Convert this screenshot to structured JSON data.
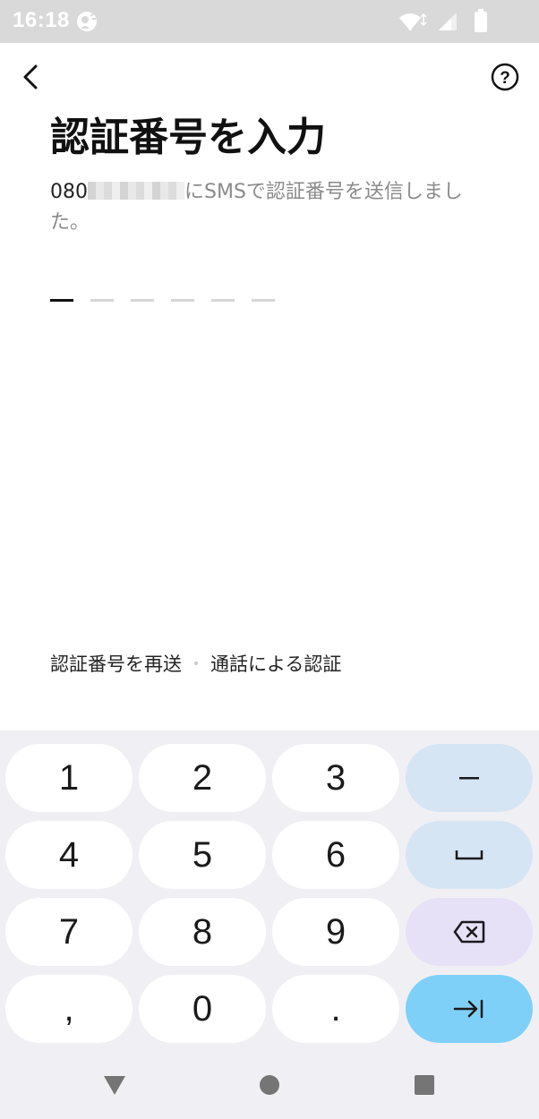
{
  "status_bar": {
    "time": "16:18",
    "left_icon": "assistant-icon",
    "right_icons": [
      "wifi-icon",
      "signal-icon",
      "battery-icon"
    ]
  },
  "header": {
    "back_icon": "chevron-left-icon",
    "help_icon": "question-circle-icon",
    "title": "認証番号を入力"
  },
  "description": {
    "number_prefix": "080",
    "number_masked": true,
    "text": "にSMSで認証番号を送信しました。"
  },
  "code_input": {
    "length": 6,
    "filled": 0,
    "active_index": 0
  },
  "links": {
    "resend": "認証番号を再送",
    "call": "通話による認証"
  },
  "keyboard": {
    "keys": [
      [
        "1",
        "2",
        "3",
        "−"
      ],
      [
        "4",
        "5",
        "6",
        "␣"
      ],
      [
        "7",
        "8",
        "9",
        "⌫"
      ],
      [
        ",",
        "0",
        ".",
        "⇥"
      ]
    ]
  },
  "navigation": {
    "back_icon": "triangle-back-icon",
    "home_icon": "circle-home-icon",
    "recents_icon": "square-recents-icon"
  },
  "colors": {
    "status_bar_bg": "#d9d9d9",
    "keyboard_bg": "#f0f0f4",
    "key_blue": "#d6e5f4",
    "key_purple": "#e6e1f7",
    "key_enter": "#7ed0f8"
  }
}
